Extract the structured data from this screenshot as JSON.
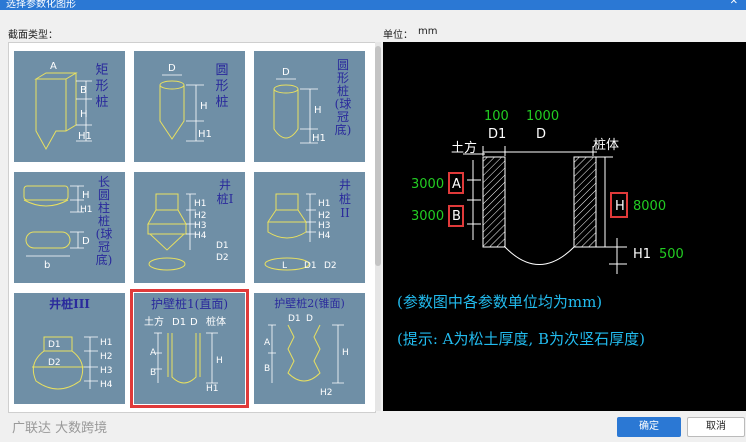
{
  "window": {
    "title": "选择参数化图形"
  },
  "labels": {
    "section_type": "截面类型：",
    "unit_label": "单位：",
    "unit_value": "mm"
  },
  "shapes": [
    {
      "caption": "矩形桩"
    },
    {
      "caption": "圆形桩"
    },
    {
      "caption": "圆形桩(球冠底)"
    },
    {
      "caption": "长圆柱桩(球冠底)"
    },
    {
      "caption": "井桩I"
    },
    {
      "caption": "井桩II"
    },
    {
      "caption": "井桩III"
    },
    {
      "caption": "护壁桩1(直面)"
    },
    {
      "caption": "护壁桩2(锥面)"
    }
  ],
  "selected_index": 7,
  "preview": {
    "top_values": [
      "100",
      "1000"
    ],
    "top_labels": [
      "D1",
      "D"
    ],
    "soil_label": "土方",
    "body_label": "桩体",
    "param_A": "A",
    "value_A": "3000",
    "param_B": "B",
    "value_B": "3000",
    "param_H": "H",
    "value_H": "8000",
    "param_H1": "H1",
    "value_H1": "500",
    "note1": "(参数图中各参数单位均为mm)",
    "note2": "(提示: A为松土厚度, B为次坚石厚度)"
  },
  "footer": {
    "logo_text": "广联达 大数跨境"
  },
  "buttons": {
    "ok": "确定",
    "cancel": "取消"
  },
  "colors": {
    "accent": "#2b78d4",
    "selection": "#e03a3a",
    "cell_bg": "#6f8fa6",
    "preview_green": "#22cc22",
    "preview_cyan": "#22bbee"
  }
}
